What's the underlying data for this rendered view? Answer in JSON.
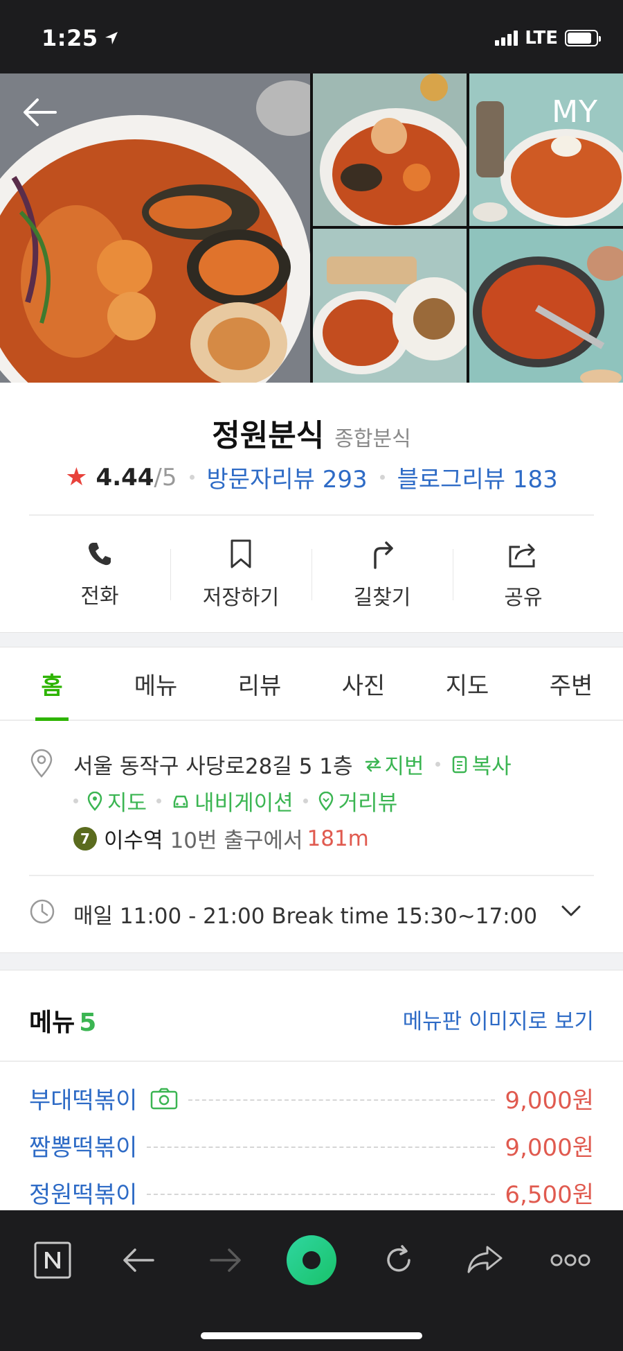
{
  "status_bar": {
    "time": "1:25",
    "carrier": "LTE",
    "battery_level": 0.85
  },
  "header": {
    "back_label": "back",
    "my_label": "MY"
  },
  "place": {
    "name": "정원분식",
    "category": "종합분식",
    "rating": "4.44",
    "rating_max": "/5",
    "visitor_review_label": "방문자리뷰 293",
    "blog_review_label": "블로그리뷰 183"
  },
  "actions": [
    {
      "label": "전화",
      "icon": "phone-icon"
    },
    {
      "label": "저장하기",
      "icon": "bookmark-icon"
    },
    {
      "label": "길찾기",
      "icon": "directions-icon"
    },
    {
      "label": "공유",
      "icon": "share-icon"
    }
  ],
  "tabs": [
    {
      "label": "홈",
      "active": true
    },
    {
      "label": "메뉴"
    },
    {
      "label": "리뷰"
    },
    {
      "label": "사진"
    },
    {
      "label": "지도"
    },
    {
      "label": "주변"
    }
  ],
  "address": {
    "text": "서울 동작구 사당로28길 5 1층",
    "jibun_label": "지번",
    "copy_label": "복사",
    "map_label": "지도",
    "navigation_label": "내비게이션",
    "streetview_label": "거리뷰",
    "subway_line": "7",
    "station": "이수역",
    "exit_text": "10번 출구에서",
    "distance": "181m"
  },
  "hours": {
    "text": "매일 11:00 - 21:00 Break time 15:30~17:00"
  },
  "menu": {
    "title": "메뉴",
    "count": "5",
    "view_image_label": "메뉴판 이미지로 보기",
    "items": [
      {
        "name": "부대떡볶이",
        "price": "9,000원",
        "has_photo": true
      },
      {
        "name": "짬뽕떡볶이",
        "price": "9,000원",
        "has_photo": false
      },
      {
        "name": "정원떡볶이",
        "price": "6,500원",
        "has_photo": false
      }
    ]
  },
  "colors": {
    "accent_green": "#2db400",
    "link_blue": "#2e6bc6",
    "price_red": "#e05a4f",
    "star_red": "#e8423b"
  }
}
